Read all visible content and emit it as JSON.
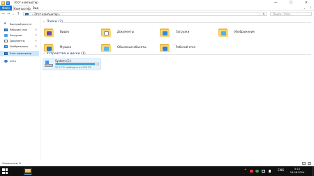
{
  "window": {
    "title": "Этот компьютер",
    "controls": {
      "minimize": "—",
      "maximize": "☐",
      "close": "✕"
    }
  },
  "ribbon": {
    "tabs": [
      "Файл",
      "Компьютер",
      "Вид"
    ],
    "help": "?",
    "collapse": "⌄"
  },
  "address": {
    "back": "←",
    "forward": "→",
    "recent": "⌄",
    "up": "↑",
    "path_prefix": "›",
    "path": "Этот компьютер",
    "path_separator": "›",
    "dropdown": "⌄",
    "refresh": "↻",
    "search_placeholder": "Поиск: Этот..."
  },
  "sidebar": {
    "items": [
      {
        "label": "Быстрый доступ",
        "icon": "star-icon",
        "pinned": false
      },
      {
        "label": "Рабочий стол",
        "icon": "desktop-icon",
        "pinned": true
      },
      {
        "label": "Загрузки",
        "icon": "downloads-icon",
        "pinned": true
      },
      {
        "label": "Документы",
        "icon": "documents-icon",
        "pinned": true
      },
      {
        "label": "Изображения",
        "icon": "pictures-icon",
        "pinned": true
      },
      {
        "label": "Этот компьютер",
        "icon": "computer-icon",
        "pinned": false,
        "selected": true
      },
      {
        "label": "Сеть",
        "icon": "network-icon",
        "pinned": false
      }
    ],
    "pin_glyph": "✎"
  },
  "main": {
    "folders_group": {
      "label": "Папки (7)",
      "chevron": "⌄"
    },
    "folders": [
      {
        "label": "Видео",
        "icon": "videos-folder-icon",
        "glyph_color": "#6b4cb5"
      },
      {
        "label": "Документы",
        "icon": "documents-folder-icon",
        "glyph_color": "#ffffff"
      },
      {
        "label": "Загрузки",
        "icon": "downloads-folder-icon",
        "glyph_color": "#2f8ae0"
      },
      {
        "label": "Изображения",
        "icon": "pictures-folder-icon",
        "glyph_color": "#4fb0ea"
      },
      {
        "label": "Музыка",
        "icon": "music-folder-icon",
        "glyph_color": "#2b79c0"
      },
      {
        "label": "Объемные объекты",
        "icon": "3d-objects-folder-icon",
        "glyph_color": "#5ab7f0"
      },
      {
        "label": "Рабочий стол",
        "icon": "desktop-folder-icon",
        "glyph_color": "#2f80d6"
      }
    ],
    "devices_group": {
      "label": "Устройства и диски (1)",
      "chevron": "⌄"
    },
    "drives": [
      {
        "name": "System (C:)",
        "free_text": "20,1 ГБ свободно из 230 ГБ",
        "used_fraction": 0.91,
        "bar_color": "#26a0da",
        "icon": "drive-icon"
      }
    ]
  },
  "status": {
    "items": "Элементов: 8",
    "details_view": "details-view-icon",
    "tiles_view": "tiles-view-icon"
  },
  "taskbar": {
    "start_icon": "windows-start-icon",
    "apps": [
      {
        "name": "explorer-icon",
        "active": true
      }
    ],
    "tray_chevron": "^",
    "tray_icons": [
      {
        "name": "red-app-tray-icon",
        "color": "#e23b3b"
      },
      {
        "name": "green-app-tray-icon",
        "color": "#38b24a"
      },
      {
        "name": "network-tray-icon",
        "color": "#ffffff"
      },
      {
        "name": "volume-tray-icon",
        "color": "#ffffff"
      }
    ],
    "language": "ENG",
    "time": "5:10",
    "date": "16.08.2024"
  }
}
